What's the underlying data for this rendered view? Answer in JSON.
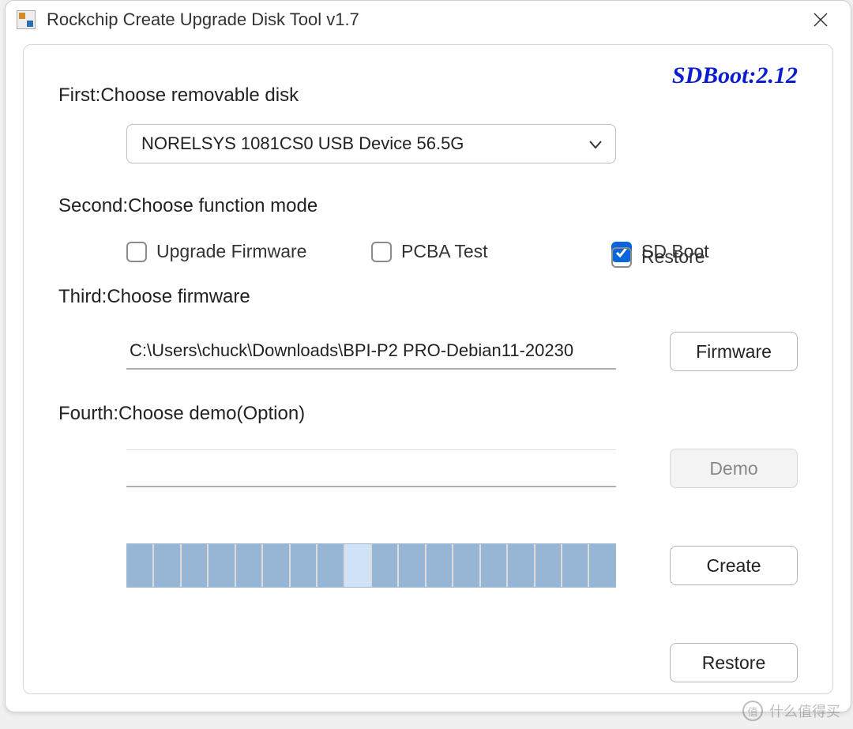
{
  "window": {
    "title": "Rockchip Create Upgrade Disk Tool v1.7"
  },
  "status": {
    "sdboot": "SDBoot:2.12"
  },
  "section1": {
    "label": "First:Choose removable disk",
    "combo_value": "NORELSYS 1081CS0 USB Device   56.5G"
  },
  "section2": {
    "label": "Second:Choose function mode",
    "options": {
      "upgrade": {
        "label": "Upgrade Firmware",
        "checked": false
      },
      "pcba": {
        "label": "PCBA Test",
        "checked": false
      },
      "sdboot": {
        "label": "SD Boot",
        "checked": true
      },
      "restore": {
        "label": "Restore",
        "checked": false
      }
    }
  },
  "section3": {
    "label": "Third:Choose firmware",
    "path": "C:\\Users\\chuck\\Downloads\\BPI-P2 PRO-Debian11-20230",
    "button": "Firmware"
  },
  "section4": {
    "label": "Fourth:Choose demo(Option)",
    "path": "",
    "button": "Demo"
  },
  "progress": {
    "segments": 18,
    "light_index": 8
  },
  "buttons": {
    "create": "Create",
    "restore": "Restore"
  },
  "watermark": "什么值得买"
}
